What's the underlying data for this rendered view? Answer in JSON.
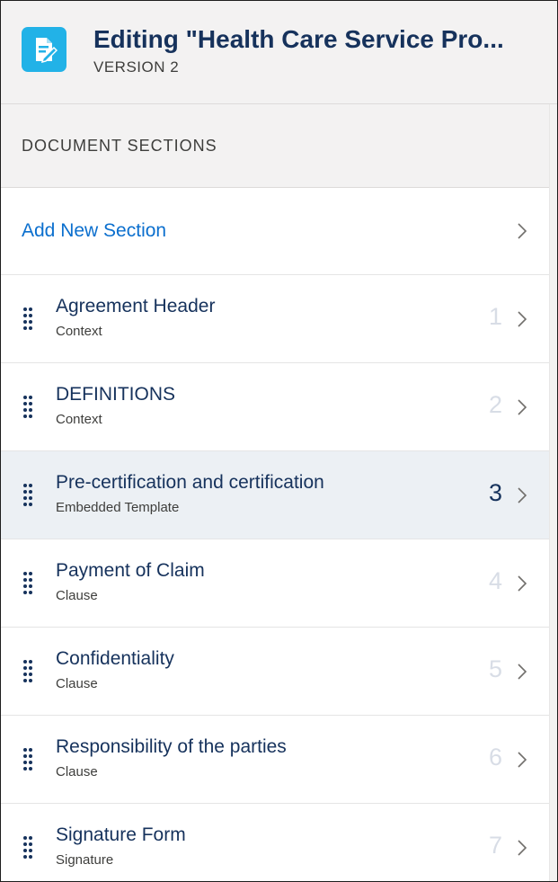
{
  "header": {
    "title": "Editing \"Health Care Service Pro...",
    "subtitle": "VERSION 2",
    "icon": "document-edit-icon",
    "icon_color": "#22b2e7"
  },
  "panel": {
    "heading": "DOCUMENT SECTIONS",
    "add_label": "Add New Section",
    "sections": [
      {
        "title": "Agreement Header",
        "type": "Context",
        "number": "1"
      },
      {
        "title": "DEFINITIONS",
        "type": "Context",
        "number": "2"
      },
      {
        "title": "Pre-certification and certification",
        "type": "Embedded Template",
        "number": "3",
        "selected": true
      },
      {
        "title": "Payment of Claim",
        "type": "Clause",
        "number": "4"
      },
      {
        "title": "Confidentiality",
        "type": "Clause",
        "number": "5"
      },
      {
        "title": "Responsibility of the parties",
        "type": "Clause",
        "number": "6"
      },
      {
        "title": "Signature Form",
        "type": "Signature",
        "number": "7"
      }
    ]
  },
  "colors": {
    "link": "#0b6fce",
    "title": "#16325c",
    "selected_row": "#ecf0f4",
    "muted_number": "#d8dde6"
  }
}
